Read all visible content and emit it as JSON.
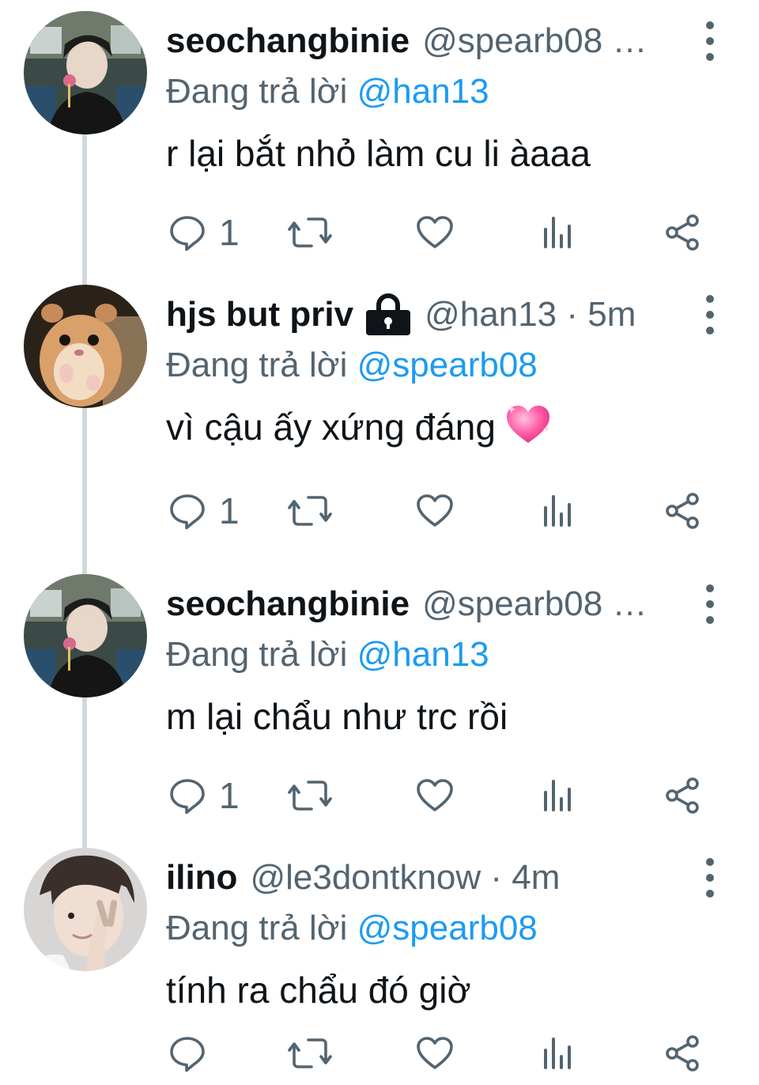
{
  "reply_prefix": "Đang trả lời",
  "colors": {
    "accent": "#1d9bf0",
    "secondary": "#536471",
    "thread_line": "#cfd9de"
  },
  "tweets": [
    {
      "name": "seochangbinie",
      "handle": "@spearb08 …",
      "reply_to": "@han13",
      "text": "r lại bắt nhỏ làm cu li àaaa",
      "reply_count": "1",
      "locked": false
    },
    {
      "name": "hjs but priv",
      "handle": "@han13 · 5m",
      "reply_to": "@spearb08",
      "text": "vì cậu ấy xứng đáng",
      "emoji": "sparkling-heart",
      "reply_count": "1",
      "locked": true
    },
    {
      "name": "seochangbinie",
      "handle": "@spearb08 …",
      "reply_to": "@han13",
      "text": "m lại chẩu như trc rồi",
      "reply_count": "1",
      "locked": false
    },
    {
      "name": "ilino",
      "handle": "@le3dontknow · 4m",
      "reply_to": "@spearb08",
      "text": "tính ra chẩu đó giờ",
      "reply_count": "",
      "locked": false
    }
  ]
}
